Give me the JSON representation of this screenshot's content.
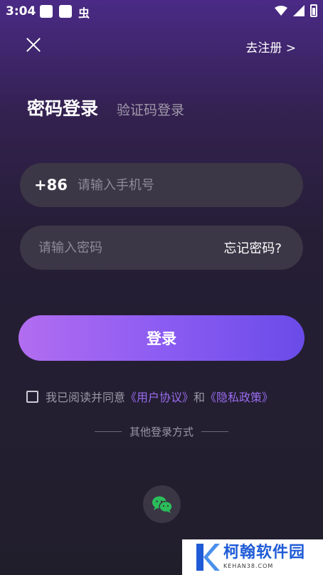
{
  "status_bar": {
    "time": "3:04",
    "bug_char": "虫",
    "icons": [
      "notification-icon",
      "notification-icon",
      "wifi-icon",
      "signal-icon",
      "battery-icon"
    ]
  },
  "header": {
    "close_icon": "close-icon",
    "register_link": "去注册 >"
  },
  "tabs": {
    "active": "密码登录",
    "inactive": "验证码登录"
  },
  "phone_field": {
    "prefix": "+86",
    "placeholder": "请输入手机号",
    "value": ""
  },
  "password_field": {
    "placeholder": "请输入密码",
    "value": "",
    "forgot_label": "忘记密码?"
  },
  "login_button": {
    "label": "登录"
  },
  "agreement": {
    "checked": false,
    "prefix": "我已阅读并同意",
    "user_agreement": "《用户协议》",
    "and": "和",
    "privacy_policy": "《隐私政策》"
  },
  "other_login": {
    "label": "其他登录方式",
    "icon": "wechat-icon"
  },
  "watermark": {
    "title": "柯翰软件园",
    "domain": "KEHAN38.COM"
  },
  "colors": {
    "accent": "#9a6cf0",
    "button_start": "#b26df0",
    "button_end": "#6a4be8",
    "field_bg": "#3b3746",
    "wechat_green": "#2bbd5a"
  }
}
